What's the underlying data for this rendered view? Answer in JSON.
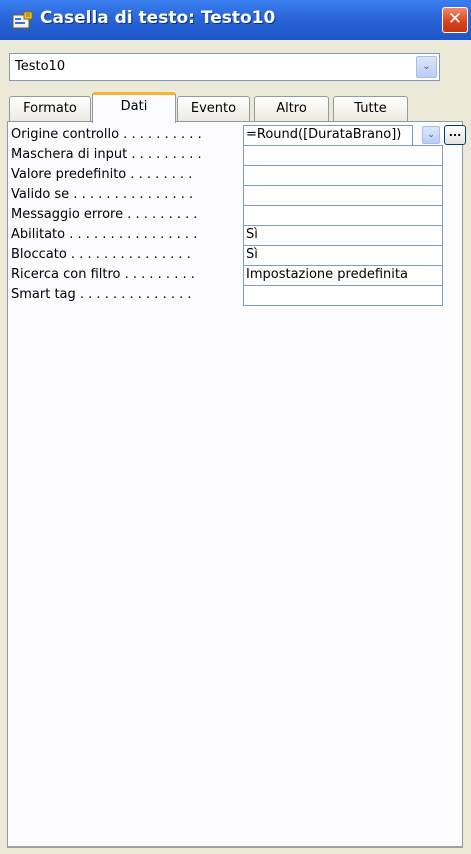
{
  "window": {
    "title": "Casella di testo: Testo10",
    "close_symbol": "✕",
    "icon": "properties-icon"
  },
  "object_selector": {
    "value": "Testo10",
    "button_symbol": "⌄"
  },
  "tabs": [
    {
      "label": "Formato",
      "active": false
    },
    {
      "label": "Dati",
      "active": true
    },
    {
      "label": "Evento",
      "active": false
    },
    {
      "label": "Altro",
      "active": false
    },
    {
      "label": "Tutte",
      "active": false
    }
  ],
  "properties": [
    {
      "label": "Origine controllo . . . . . . . . . .",
      "value": "=Round([DurataBrano])"
    },
    {
      "label": "Maschera di input . . . . . . . . .",
      "value": ""
    },
    {
      "label": "Valore predefinito . . . . . . . .",
      "value": ""
    },
    {
      "label": "Valido se . . . . . . . . . . . . . . .",
      "value": ""
    },
    {
      "label": "Messaggio errore . . . . . . . . .",
      "value": ""
    },
    {
      "label": "Abilitato . . . . . . . . . . . . . . . .",
      "value": "Sì"
    },
    {
      "label": "Bloccato . . . . . . . . . . . . . . .",
      "value": "Sì"
    },
    {
      "label": "Ricerca con filtro . . . . . . . . .",
      "value": "Impostazione predefinita"
    },
    {
      "label": "Smart tag . . . . . . . . . . . . . .",
      "value": ""
    }
  ],
  "row_controls": {
    "dropdown_symbol": "⌄",
    "build_label": "..."
  }
}
